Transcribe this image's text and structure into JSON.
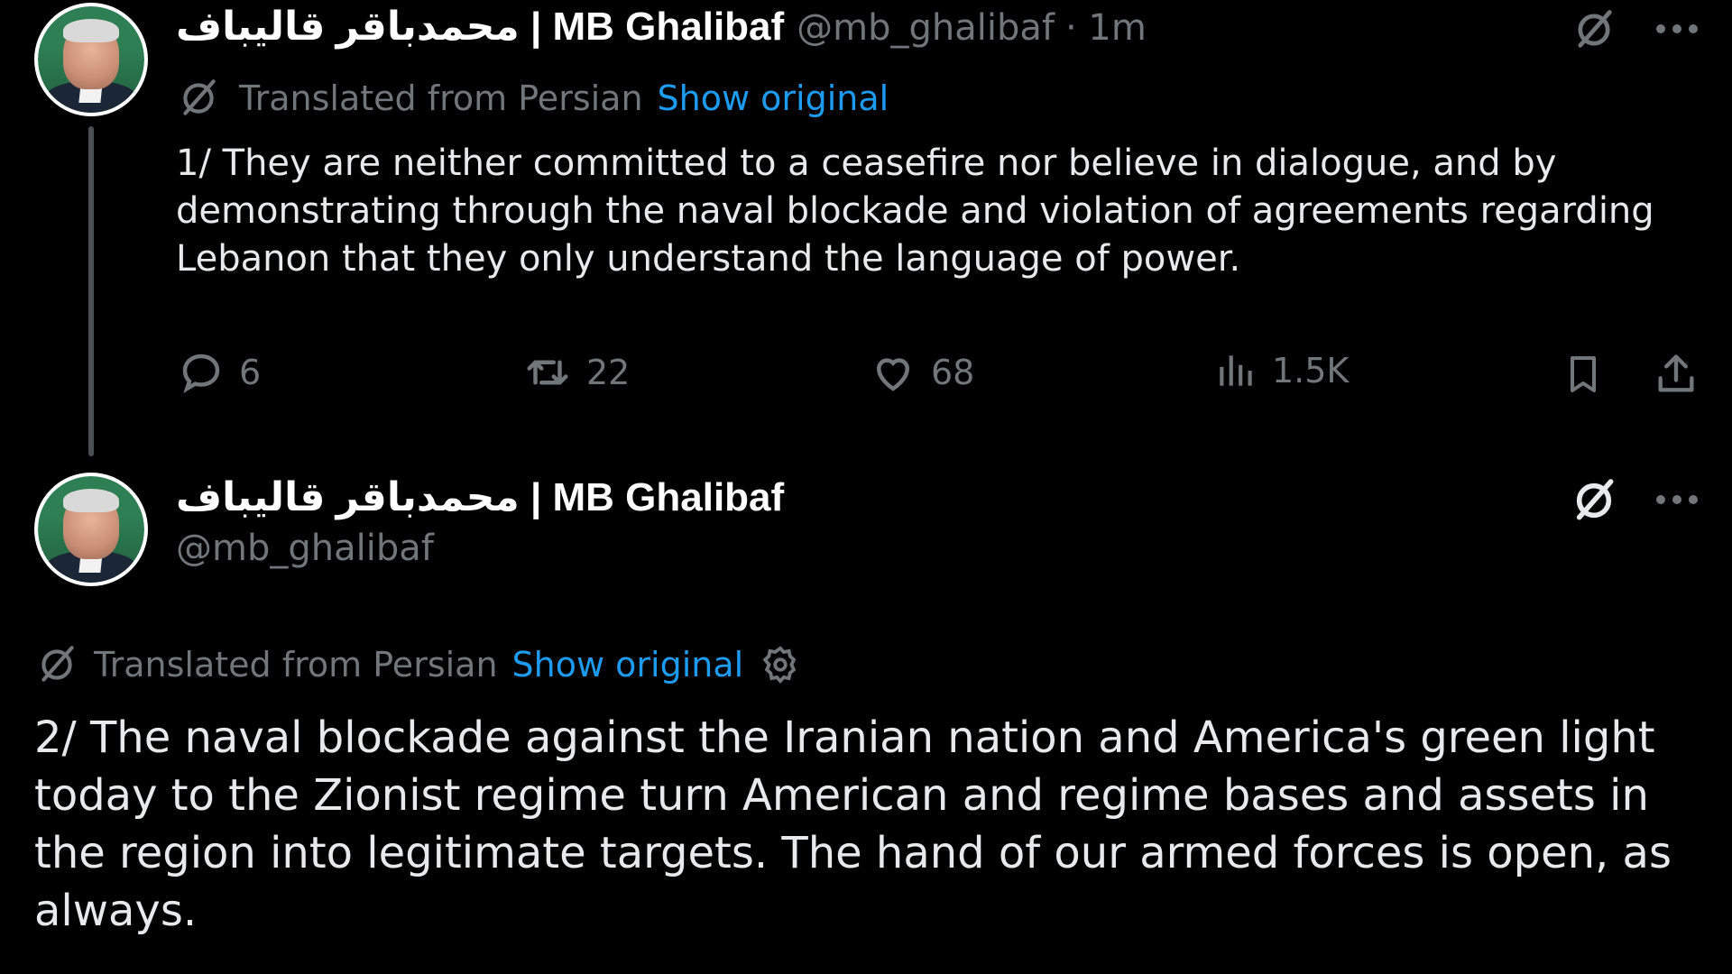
{
  "tweet1": {
    "display_name": "محمدباقر قالیباف | MB Ghalibaf",
    "handle": "@mb_ghalibaf",
    "time": "· 1m",
    "translated_label": "Translated from Persian",
    "show_original": "Show original",
    "text": "1/ They are neither committed to a ceasefire nor believe in dialogue, and by demonstrating through the naval blockade and violation of agreements regarding Lebanon that they only understand the language of power.",
    "replies": "6",
    "reposts": "22",
    "likes": "68",
    "views": "1.5K",
    "icons": [
      "grok-icon",
      "more-icon",
      "reply-icon",
      "repost-icon",
      "like-icon",
      "views-icon",
      "bookmark-icon",
      "share-icon"
    ]
  },
  "tweet2": {
    "display_name": "محمدباقر قالیباف | MB Ghalibaf",
    "handle": "@mb_ghalibaf",
    "translated_label": "Translated from Persian",
    "show_original": "Show original",
    "text": "2/ The naval blockade against the Iranian nation and America's green light today to the Zionist regime turn American and regime bases and assets in the region into legitimate targets. The hand of our armed forces is open, as always.",
    "icons": [
      "grok-icon",
      "more-icon",
      "settings-icon"
    ]
  },
  "colors": {
    "background": "#000000",
    "text": "#e7e9ea",
    "muted": "#71767b",
    "link": "#1d9bf0"
  }
}
